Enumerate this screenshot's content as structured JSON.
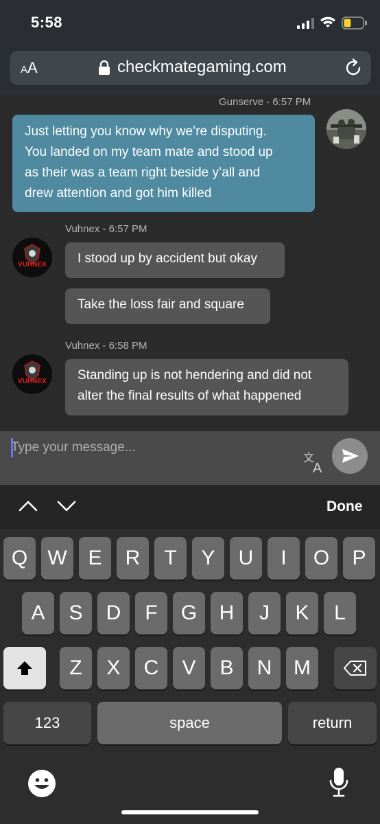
{
  "status_bar": {
    "time": "5:58"
  },
  "browser": {
    "aa_label": "A",
    "aa_label_big": "A",
    "domain": "checkmategaming.com"
  },
  "chat": {
    "messages": [
      {
        "sender": "Gunserve",
        "meta": "Gunserve - 6:57 PM",
        "text_lines": [
          "Just letting you know why we’re disputing.",
          "You landed on my team mate and stood up",
          "as their was a team right beside y’all and",
          "drew attention and got him killed"
        ]
      },
      {
        "sender": "Vuhnex",
        "meta": "Vuhnex - 6:57 PM",
        "bubbles": [
          "I stood up by accident but okay",
          "Take the loss fair and square"
        ]
      },
      {
        "sender": "Vuhnex",
        "meta": "Vuhnex - 6:58 PM",
        "text_lines": [
          "Standing up is not hendering and did not",
          "alter the final results of what happened"
        ]
      }
    ],
    "avatar_label": "VUHNEX"
  },
  "composer": {
    "placeholder": "Type your message..."
  },
  "accessory": {
    "done_label": "Done"
  },
  "keyboard": {
    "row1": [
      "Q",
      "W",
      "E",
      "R",
      "T",
      "Y",
      "U",
      "I",
      "O",
      "P"
    ],
    "row2": [
      "A",
      "S",
      "D",
      "F",
      "G",
      "H",
      "J",
      "K",
      "L"
    ],
    "row3": [
      "Z",
      "X",
      "C",
      "V",
      "B",
      "N",
      "M"
    ],
    "numbers_label": "123",
    "space_label": "space",
    "return_label": "return"
  },
  "colors": {
    "my_bubble": "#4f8aa0",
    "their_bubble": "#555555",
    "background": "#2b2b2b"
  }
}
